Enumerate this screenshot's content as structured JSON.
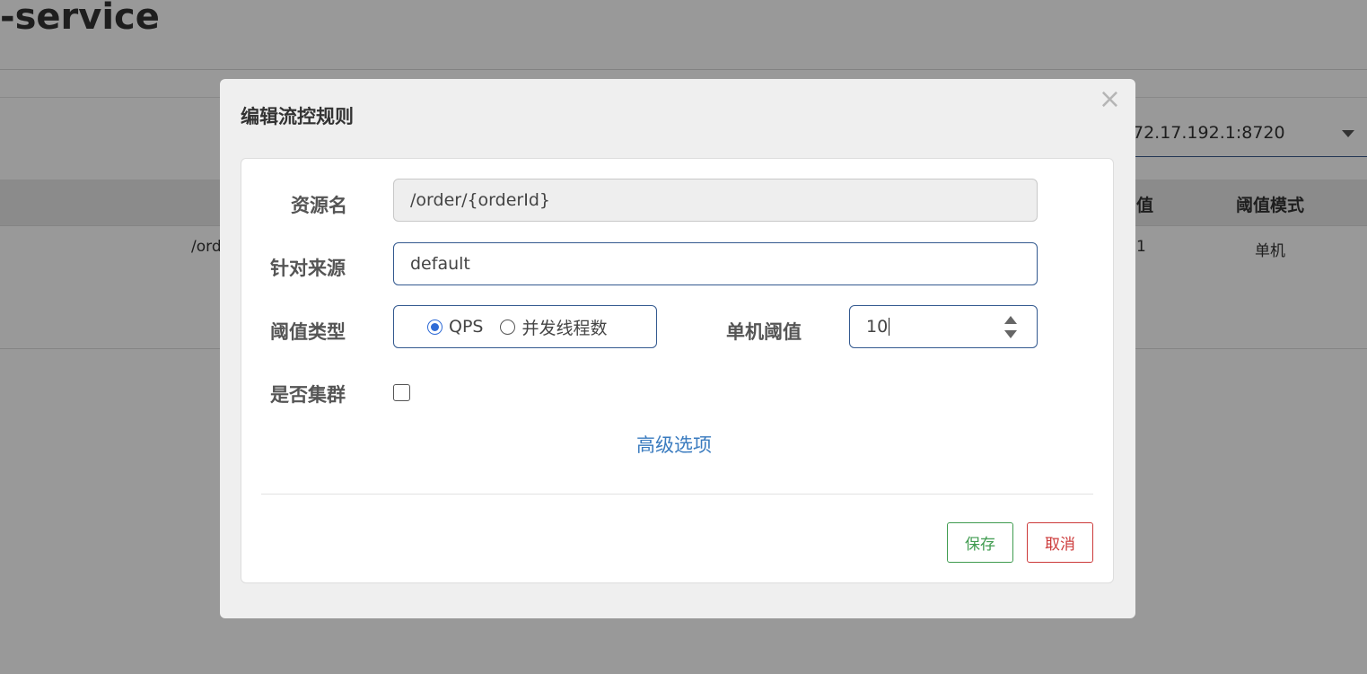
{
  "background": {
    "app_title": "-service",
    "machine_select_value": "72.17.192.1:8720",
    "table": {
      "headers": {
        "threshold": "值",
        "threshold_mode": "阈值模式"
      },
      "row": {
        "resource": "/ord",
        "threshold": "1",
        "mode": "单机"
      }
    }
  },
  "dialog": {
    "title": "编辑流控规则",
    "close_symbol": "×",
    "resource_label": "资源名",
    "resource_value": "/order/{orderId}",
    "origin_label": "针对来源",
    "origin_value": "default",
    "threshold_type_label": "阈值类型",
    "threshold_type_options": [
      "QPS",
      "并发线程数"
    ],
    "threshold_type_selected": "QPS",
    "single_threshold_label": "单机阈值",
    "single_threshold_value": "10",
    "cluster_label": "是否集群",
    "cluster_checked": false,
    "advanced_link": "高级选项",
    "save_button": "保存",
    "cancel_button": "取消"
  },
  "colors": {
    "overlay": "rgba(0,0,0,0.4)",
    "modal_bg": "#efefef",
    "input_border": "#33598f",
    "radio_accent": "#2f6bd6",
    "link": "#3a7bbf",
    "save": "#3f9b4f",
    "cancel": "#cc3a3a"
  },
  "icons": {
    "close": "close-icon",
    "stepper": "spinner-arrows-icon",
    "select_caret": "caret-down-icon"
  }
}
